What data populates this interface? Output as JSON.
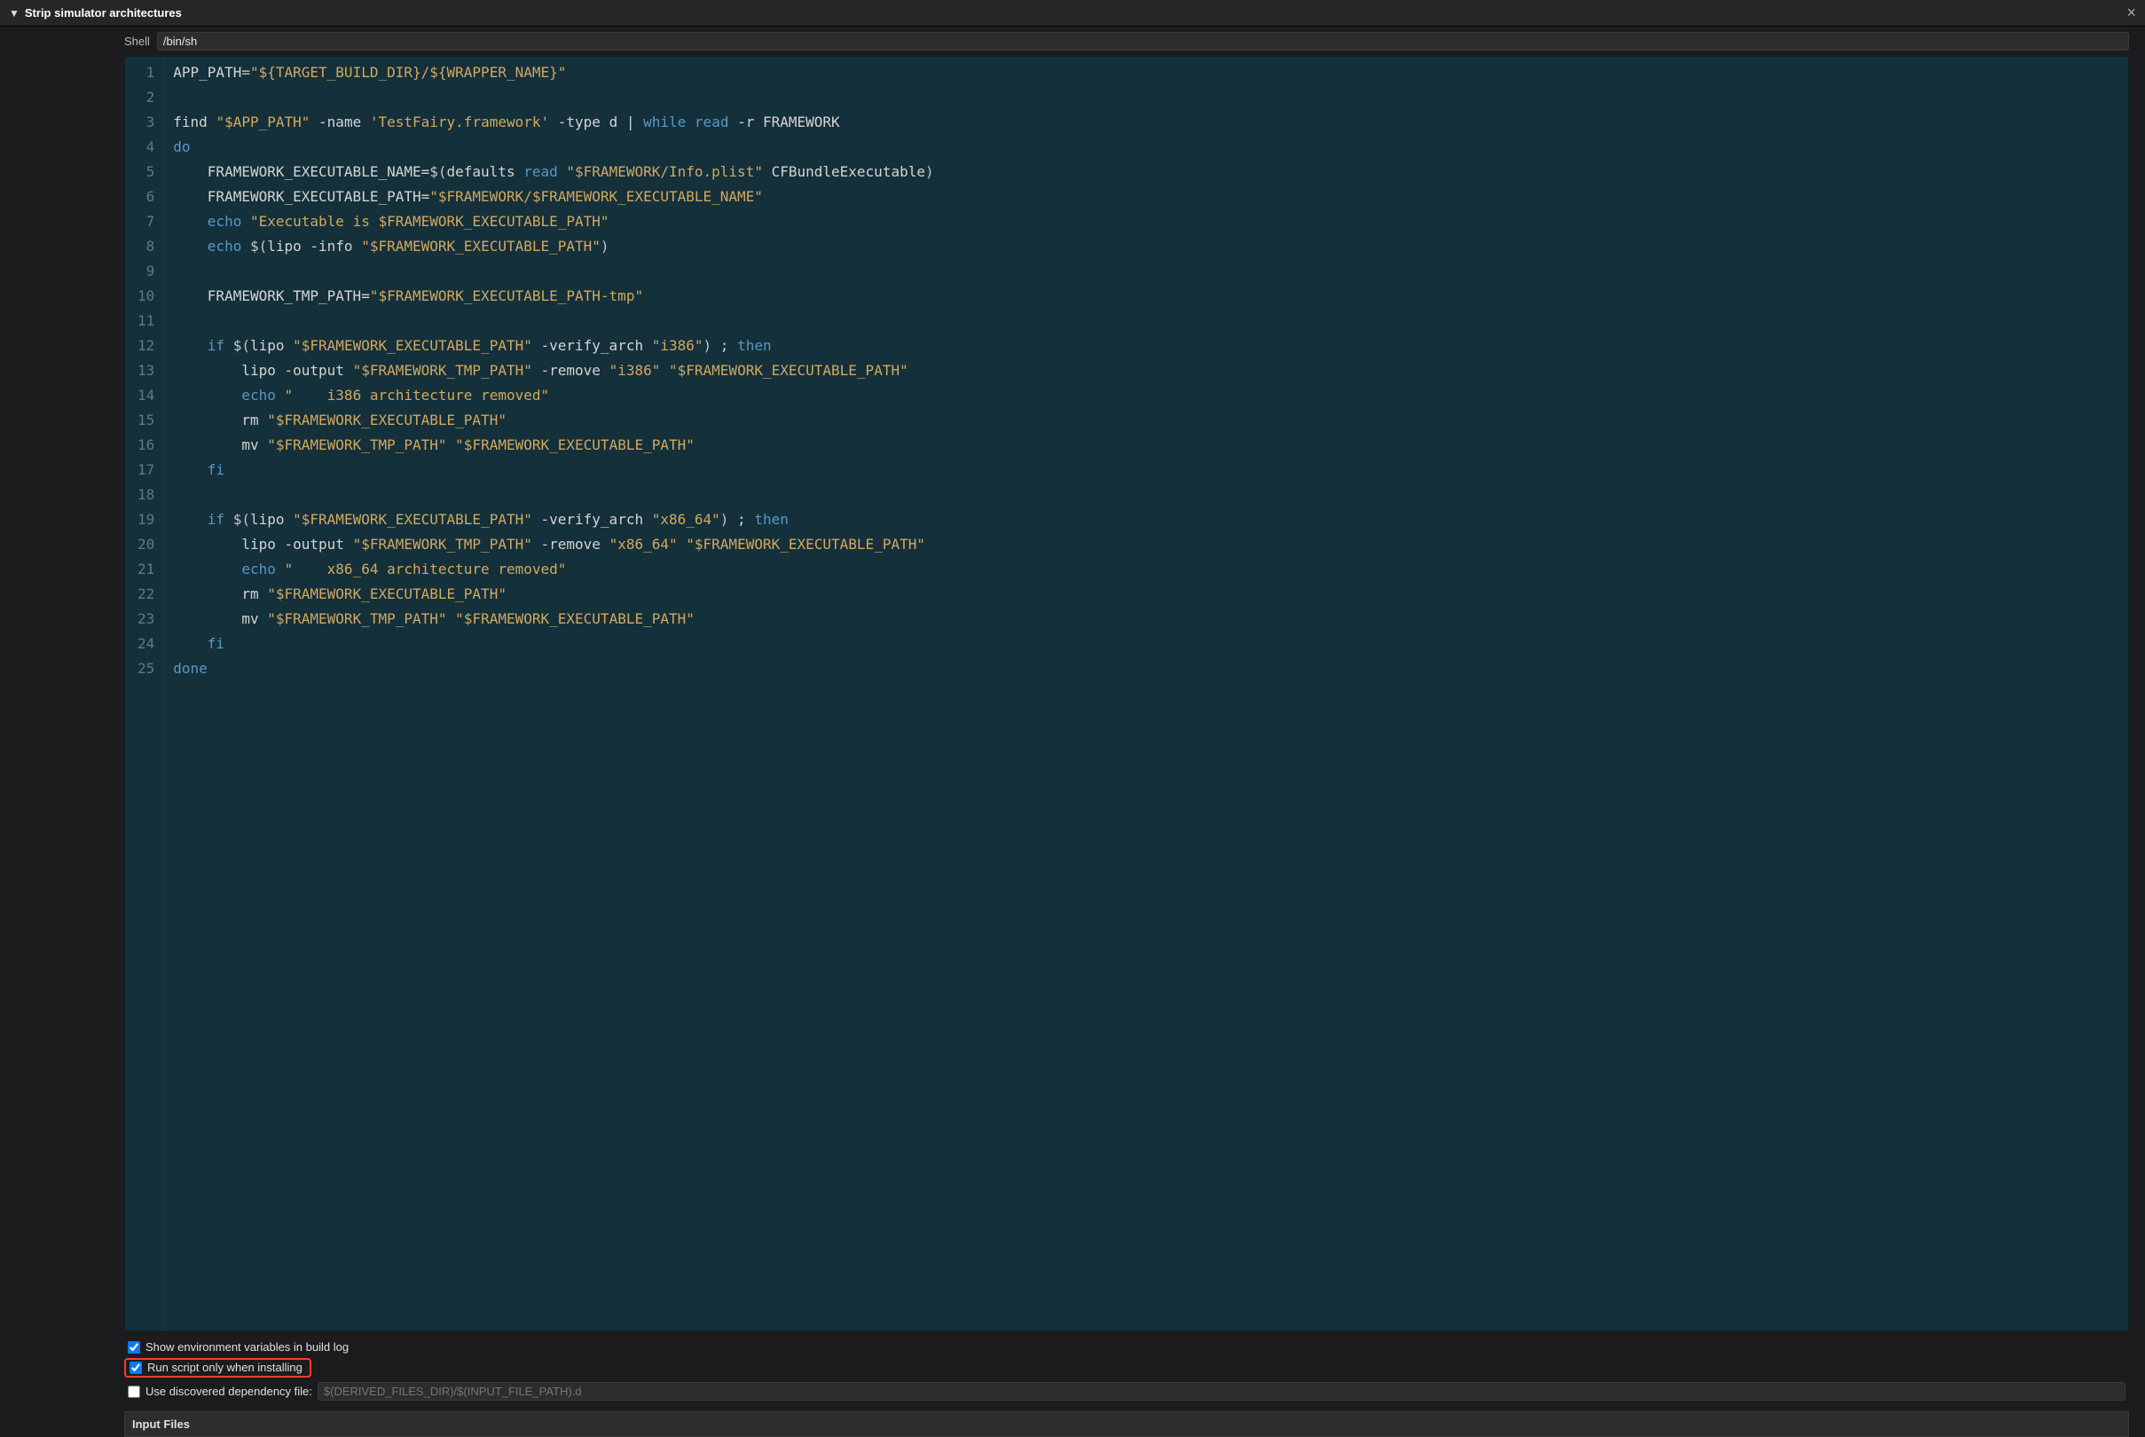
{
  "header": {
    "title": "Strip simulator architectures",
    "close_glyph": "×"
  },
  "shell": {
    "label": "Shell",
    "value": "/bin/sh"
  },
  "code_lines": [
    [
      {
        "c": "var",
        "t": "APP_PATH"
      },
      {
        "c": "punct",
        "t": "="
      },
      {
        "c": "str",
        "t": "\"${TARGET_BUILD_DIR}/${WRAPPER_NAME}\""
      }
    ],
    [],
    [
      {
        "c": "var",
        "t": "find "
      },
      {
        "c": "str",
        "t": "\"$APP_PATH\""
      },
      {
        "c": "var",
        "t": " -name "
      },
      {
        "c": "str",
        "t": "'TestFairy.framework'"
      },
      {
        "c": "var",
        "t": " -type d | "
      },
      {
        "c": "key",
        "t": "while"
      },
      {
        "c": "var",
        "t": " "
      },
      {
        "c": "cmd",
        "t": "read"
      },
      {
        "c": "var",
        "t": " -r FRAMEWORK"
      }
    ],
    [
      {
        "c": "key",
        "t": "do"
      }
    ],
    [
      {
        "c": "var",
        "t": "    FRAMEWORK_EXECUTABLE_NAME="
      },
      {
        "c": "punct",
        "t": "$("
      },
      {
        "c": "var",
        "t": "defaults "
      },
      {
        "c": "cmd",
        "t": "read"
      },
      {
        "c": "var",
        "t": " "
      },
      {
        "c": "str",
        "t": "\"$FRAMEWORK/Info.plist\""
      },
      {
        "c": "var",
        "t": " CFBundleExecutable"
      },
      {
        "c": "punct",
        "t": ")"
      }
    ],
    [
      {
        "c": "var",
        "t": "    FRAMEWORK_EXECUTABLE_PATH="
      },
      {
        "c": "str",
        "t": "\"$FRAMEWORK/$FRAMEWORK_EXECUTABLE_NAME\""
      }
    ],
    [
      {
        "c": "var",
        "t": "    "
      },
      {
        "c": "cmd",
        "t": "echo"
      },
      {
        "c": "var",
        "t": " "
      },
      {
        "c": "str",
        "t": "\"Executable is $FRAMEWORK_EXECUTABLE_PATH\""
      }
    ],
    [
      {
        "c": "var",
        "t": "    "
      },
      {
        "c": "cmd",
        "t": "echo"
      },
      {
        "c": "var",
        "t": " "
      },
      {
        "c": "punct",
        "t": "$("
      },
      {
        "c": "var",
        "t": "lipo -info "
      },
      {
        "c": "str",
        "t": "\"$FRAMEWORK_EXECUTABLE_PATH\""
      },
      {
        "c": "punct",
        "t": ")"
      }
    ],
    [],
    [
      {
        "c": "var",
        "t": "    FRAMEWORK_TMP_PATH="
      },
      {
        "c": "str",
        "t": "\"$FRAMEWORK_EXECUTABLE_PATH-tmp\""
      }
    ],
    [],
    [
      {
        "c": "var",
        "t": "    "
      },
      {
        "c": "key",
        "t": "if"
      },
      {
        "c": "var",
        "t": " "
      },
      {
        "c": "punct",
        "t": "$("
      },
      {
        "c": "var",
        "t": "lipo "
      },
      {
        "c": "str",
        "t": "\"$FRAMEWORK_EXECUTABLE_PATH\""
      },
      {
        "c": "var",
        "t": " -verify_arch "
      },
      {
        "c": "str",
        "t": "\"i386\""
      },
      {
        "c": "punct",
        "t": ")"
      },
      {
        "c": "var",
        "t": " ; "
      },
      {
        "c": "key",
        "t": "then"
      }
    ],
    [
      {
        "c": "var",
        "t": "        lipo -output "
      },
      {
        "c": "str",
        "t": "\"$FRAMEWORK_TMP_PATH\""
      },
      {
        "c": "var",
        "t": " -remove "
      },
      {
        "c": "str",
        "t": "\"i386\""
      },
      {
        "c": "var",
        "t": " "
      },
      {
        "c": "str",
        "t": "\"$FRAMEWORK_EXECUTABLE_PATH\""
      }
    ],
    [
      {
        "c": "var",
        "t": "        "
      },
      {
        "c": "cmd",
        "t": "echo"
      },
      {
        "c": "var",
        "t": " "
      },
      {
        "c": "str",
        "t": "\"    i386 architecture removed\""
      }
    ],
    [
      {
        "c": "var",
        "t": "        rm "
      },
      {
        "c": "str",
        "t": "\"$FRAMEWORK_EXECUTABLE_PATH\""
      }
    ],
    [
      {
        "c": "var",
        "t": "        mv "
      },
      {
        "c": "str",
        "t": "\"$FRAMEWORK_TMP_PATH\""
      },
      {
        "c": "var",
        "t": " "
      },
      {
        "c": "str",
        "t": "\"$FRAMEWORK_EXECUTABLE_PATH\""
      }
    ],
    [
      {
        "c": "var",
        "t": "    "
      },
      {
        "c": "key",
        "t": "fi"
      }
    ],
    [],
    [
      {
        "c": "var",
        "t": "    "
      },
      {
        "c": "key",
        "t": "if"
      },
      {
        "c": "var",
        "t": " "
      },
      {
        "c": "punct",
        "t": "$("
      },
      {
        "c": "var",
        "t": "lipo "
      },
      {
        "c": "str",
        "t": "\"$FRAMEWORK_EXECUTABLE_PATH\""
      },
      {
        "c": "var",
        "t": " -verify_arch "
      },
      {
        "c": "str",
        "t": "\"x86_64\""
      },
      {
        "c": "punct",
        "t": ")"
      },
      {
        "c": "var",
        "t": " ; "
      },
      {
        "c": "key",
        "t": "then"
      }
    ],
    [
      {
        "c": "var",
        "t": "        lipo -output "
      },
      {
        "c": "str",
        "t": "\"$FRAMEWORK_TMP_PATH\""
      },
      {
        "c": "var",
        "t": " -remove "
      },
      {
        "c": "str",
        "t": "\"x86_64\""
      },
      {
        "c": "var",
        "t": " "
      },
      {
        "c": "str",
        "t": "\"$FRAMEWORK_EXECUTABLE_PATH\""
      }
    ],
    [
      {
        "c": "var",
        "t": "        "
      },
      {
        "c": "cmd",
        "t": "echo"
      },
      {
        "c": "var",
        "t": " "
      },
      {
        "c": "str",
        "t": "\"    x86_64 architecture removed\""
      }
    ],
    [
      {
        "c": "var",
        "t": "        rm "
      },
      {
        "c": "str",
        "t": "\"$FRAMEWORK_EXECUTABLE_PATH\""
      }
    ],
    [
      {
        "c": "var",
        "t": "        mv "
      },
      {
        "c": "str",
        "t": "\"$FRAMEWORK_TMP_PATH\""
      },
      {
        "c": "var",
        "t": " "
      },
      {
        "c": "str",
        "t": "\"$FRAMEWORK_EXECUTABLE_PATH\""
      }
    ],
    [
      {
        "c": "var",
        "t": "    "
      },
      {
        "c": "key",
        "t": "fi"
      }
    ],
    [
      {
        "c": "key",
        "t": "done"
      }
    ]
  ],
  "options": {
    "show_env": {
      "label": "Show environment variables in build log",
      "checked": true
    },
    "run_install_only": {
      "label": "Run script only when installing",
      "checked": true
    },
    "use_dep_file": {
      "label": "Use discovered dependency file:",
      "checked": false,
      "placeholder": "$(DERIVED_FILES_DIR)/$(INPUT_FILE_PATH).d"
    }
  },
  "input_files_label": "Input Files"
}
